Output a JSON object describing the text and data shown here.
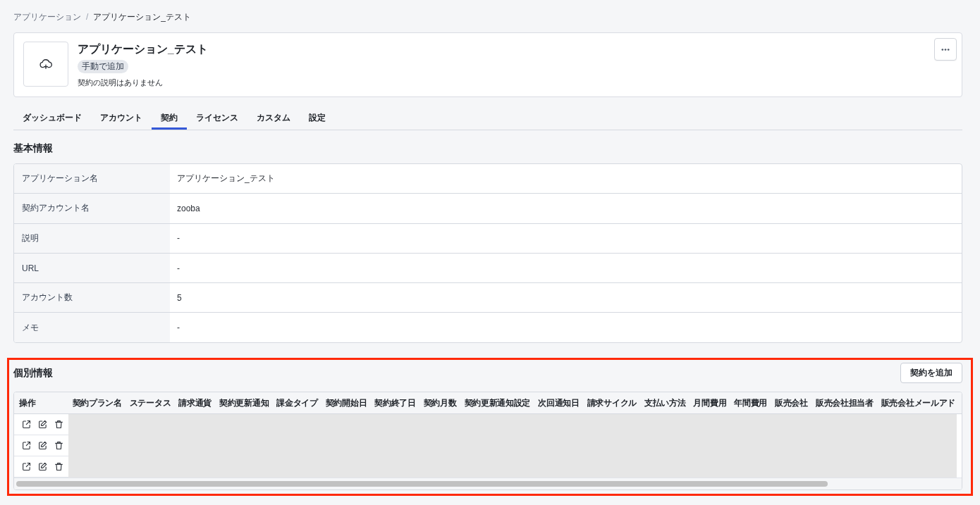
{
  "breadcrumb": {
    "items": [
      {
        "label": "アプリケーション",
        "current": false
      },
      {
        "label": "アプリケーション_テスト",
        "current": true
      }
    ],
    "separator": "/"
  },
  "header": {
    "title": "アプリケーション_テスト",
    "badge": "手動で追加",
    "description": "契約の説明はありません"
  },
  "tabs": [
    {
      "label": "ダッシュボード",
      "selected": false
    },
    {
      "label": "アカウント",
      "selected": false
    },
    {
      "label": "契約",
      "selected": true
    },
    {
      "label": "ライセンス",
      "selected": false
    },
    {
      "label": "カスタム",
      "selected": false
    },
    {
      "label": "設定",
      "selected": false
    }
  ],
  "basic_info": {
    "title": "基本情報",
    "rows": [
      {
        "label": "アプリケーション名",
        "value": "アプリケーション_テスト"
      },
      {
        "label": "契約アカウント名",
        "value": "zooba"
      },
      {
        "label": "説明",
        "value": "-"
      },
      {
        "label": "URL",
        "value": "-"
      },
      {
        "label": "アカウント数",
        "value": "5"
      },
      {
        "label": "メモ",
        "value": "-"
      }
    ]
  },
  "contracts": {
    "title": "個別情報",
    "highlighted": true,
    "add_button": "契約を追加",
    "table": {
      "columns": [
        "操作",
        "契約プラン名",
        "ステータス",
        "請求通貨",
        "契約更新通知",
        "課金タイプ",
        "契約開始日",
        "契約終了日",
        "契約月数",
        "契約更新通知設定",
        "次回通知日",
        "請求サイクル",
        "支払い方法",
        "月間費用",
        "年間費用",
        "販売会社",
        "販売会社担当者",
        "販売会社メールアド"
      ],
      "rows": [
        {
          "redacted": true
        },
        {
          "redacted": true
        },
        {
          "redacted": true
        }
      ]
    }
  }
}
